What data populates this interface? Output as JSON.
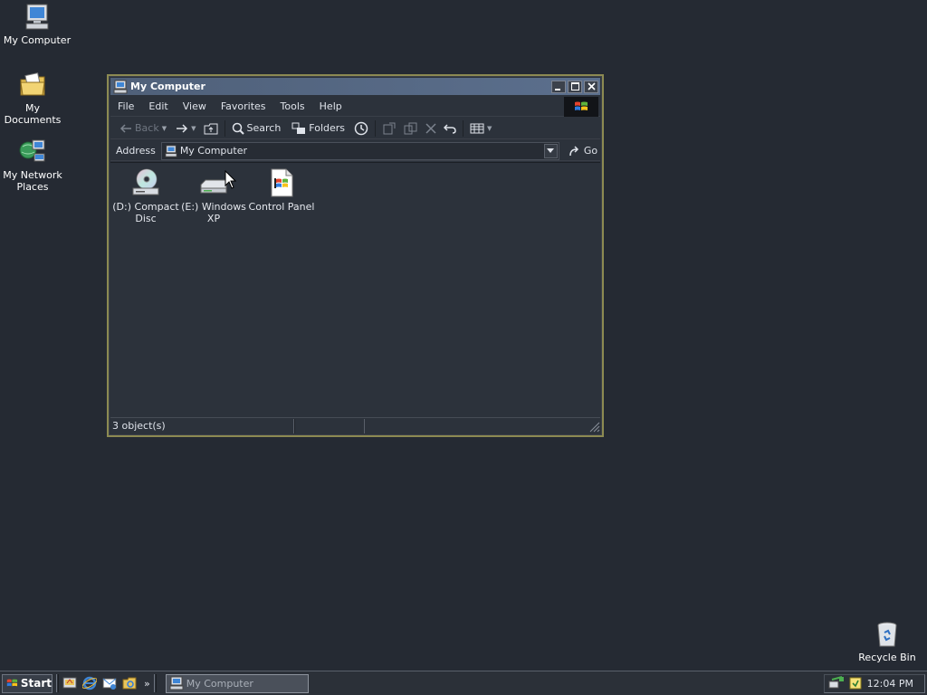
{
  "desktop": {
    "icons": [
      {
        "label": "My Computer",
        "icon": "computer-icon"
      },
      {
        "label": "My Documents",
        "icon": "folder-documents-icon"
      },
      {
        "label": "My Network Places",
        "icon": "network-icon"
      },
      {
        "label": "Recycle Bin",
        "icon": "recycle-bin-icon"
      }
    ]
  },
  "window": {
    "title": "My Computer",
    "menu": [
      "File",
      "Edit",
      "View",
      "Favorites",
      "Tools",
      "Help"
    ],
    "toolbar": {
      "back": "Back",
      "search": "Search",
      "folders": "Folders"
    },
    "address": {
      "label": "Address",
      "value": "My Computer",
      "go": "Go"
    },
    "items": [
      {
        "label": "(D:) Compact Disc",
        "icon": "cd-drive-icon"
      },
      {
        "label": "(E:) Windows XP",
        "icon": "drive-icon"
      },
      {
        "label": "Control Panel",
        "icon": "control-panel-icon"
      }
    ],
    "status": {
      "objects": "3 object(s)"
    }
  },
  "taskbar": {
    "start": "Start",
    "task": "My Computer",
    "clock": "12:04 PM"
  }
}
